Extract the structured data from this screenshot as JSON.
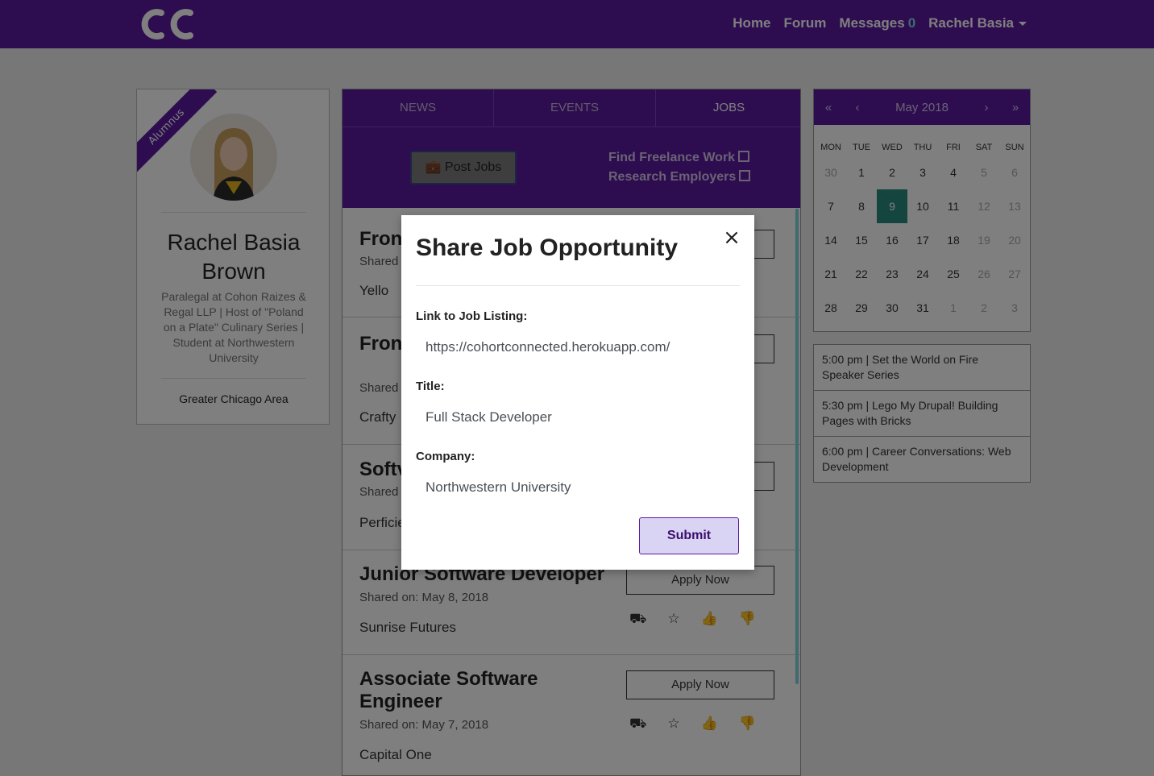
{
  "nav": {
    "logo_text": "CC",
    "links": [
      "Home",
      "Forum",
      "Messages",
      "Rachel Basia"
    ],
    "messages_count": "0",
    "brand_color": "#5b1aa0"
  },
  "profile": {
    "badge": "Alumnus",
    "name": "Rachel Basia Brown",
    "bio": "Paralegal at Cohon Raizes & Regal LLP | Host of \"Poland on a Plate\" Culinary Series | Student at Northwestern University",
    "location": "Greater Chicago Area"
  },
  "feed": {
    "tabs": [
      "NEWS",
      "EVENTS",
      "JOBS"
    ],
    "active_tab": "JOBS",
    "post_button": "Post Jobs",
    "links": [
      "Find Freelance Work",
      "Research Employers"
    ],
    "apply_label": "Apply Now",
    "jobs": [
      {
        "title": "Fron",
        "shared": "Shared",
        "company": "Yello"
      },
      {
        "title": "Fron Deve",
        "shared": "Shared",
        "company": "Crafty"
      },
      {
        "title": "Softv",
        "shared": "Shared",
        "company": "Perficie"
      },
      {
        "title": "Junior Software Developer",
        "shared": "Shared on: May 8, 2018",
        "company": "Sunrise Futures"
      },
      {
        "title": "Associate Software Engineer",
        "shared": "Shared on: May 7, 2018",
        "company": "Capital One"
      }
    ]
  },
  "calendar": {
    "prev_year": "«",
    "prev_month": "‹",
    "title": "May 2018",
    "next_month": "›",
    "next_year": "»",
    "dow": [
      "MON",
      "TUE",
      "WED",
      "THU",
      "FRI",
      "SAT",
      "SUN"
    ],
    "weeks": [
      [
        "30",
        "1",
        "2",
        "3",
        "4",
        "5",
        "6"
      ],
      [
        "7",
        "8",
        "9",
        "10",
        "11",
        "12",
        "13"
      ],
      [
        "14",
        "15",
        "16",
        "17",
        "18",
        "19",
        "20"
      ],
      [
        "21",
        "22",
        "23",
        "24",
        "25",
        "26",
        "27"
      ],
      [
        "28",
        "29",
        "30",
        "31",
        "1",
        "2",
        "3"
      ]
    ],
    "today": "9",
    "today_color": "#2a8a7f"
  },
  "events": [
    "5:00 pm | Set the World on Fire Speaker Series",
    "5:30 pm | Lego My Drupal! Building Pages with Bricks",
    "6:00 pm | Career Conversations: Web Development"
  ],
  "modal": {
    "title": "Share Job Opportunity",
    "close": "×",
    "link_label": "Link to Job Listing:",
    "link_value": "https://cohortconnected.herokuapp.com/",
    "title_label": "Title:",
    "title_value": "Full Stack Developer",
    "company_label": "Company:",
    "company_value": "Northwestern University",
    "submit": "Submit"
  }
}
